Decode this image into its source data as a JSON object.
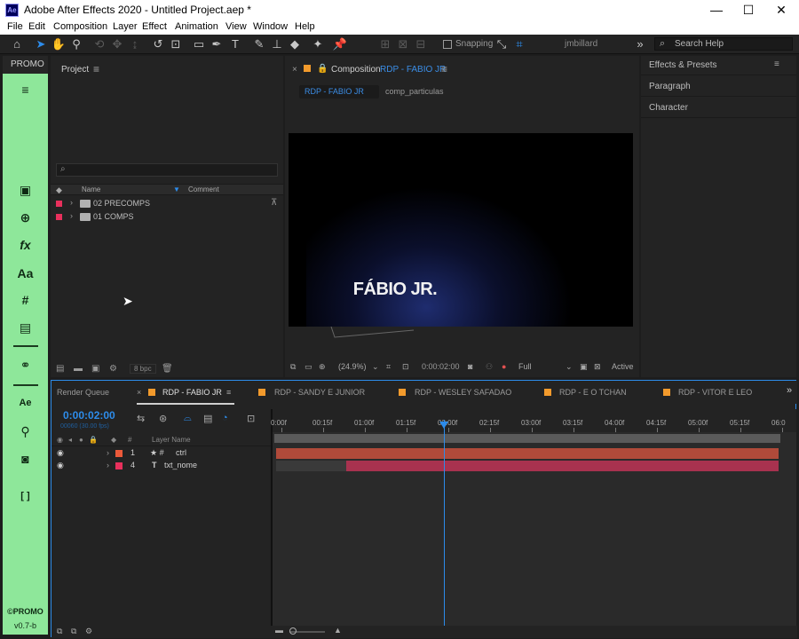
{
  "app": {
    "icon": "Ae",
    "title": "Adobe After Effects 2020 - Untitled Project.aep *",
    "window_buttons": [
      "—",
      "☐",
      "✕"
    ]
  },
  "menu": [
    "File",
    "Edit",
    "Composition",
    "Layer",
    "Effect",
    "Animation",
    "View",
    "Window",
    "Help"
  ],
  "toolbar": {
    "snapping_label": "Snapping",
    "workspace": "jmbillard",
    "search_placeholder": "Search Help"
  },
  "promo": {
    "tab_label": "PROMO",
    "logo": "©PROMO",
    "version": "v0.7-b",
    "icons": [
      "menu-icon",
      "comp-icon",
      "align-icon",
      "fx-icon",
      "text-icon",
      "grid-icon",
      "calendar-icon",
      "link-icon",
      "ae-icon",
      "search-icon",
      "camera-icon",
      "brackets-icon"
    ]
  },
  "project": {
    "tab_label": "Project",
    "columns": {
      "name": "Name",
      "comment": "Comment"
    },
    "items": [
      {
        "name": "02 PRECOMPS",
        "label_color": "#e8305c"
      },
      {
        "name": "01 COMPS",
        "label_color": "#e8305c"
      }
    ],
    "bpc": "8 bpc"
  },
  "composition": {
    "tab_prefix": "Composition",
    "tab_name": "RDP - FABIO JR",
    "breadcrumb_active": "RDP - FABIO JR",
    "breadcrumb_next": "comp_particulas",
    "viewer_text": "FÁBIO JR.",
    "zoom": "(24.9%)",
    "timecode": "0:00:02:00",
    "resolution": "Full",
    "camera": "Active"
  },
  "right_panels": [
    "Effects & Presets",
    "Paragraph",
    "Character"
  ],
  "timeline": {
    "render_queue": "Render Queue",
    "tabs": [
      {
        "label": "RDP - FABIO JR",
        "active": true
      },
      {
        "label": "RDP - SANDY E JUNIOR",
        "active": false
      },
      {
        "label": "RDP - WESLEY SAFADAO",
        "active": false
      },
      {
        "label": "RDP - E O TCHAN",
        "active": false
      },
      {
        "label": "RDP - VITOR E LEO",
        "active": false
      }
    ],
    "timecode": "0:00:02:00",
    "fps": "00060 (30.00 fps)",
    "layer_name_header": "Layer Name",
    "ruler_labels": [
      "0:00f",
      "00:15f",
      "01:00f",
      "01:15f",
      "02:00f",
      "02:15f",
      "03:00f",
      "03:15f",
      "04:00f",
      "04:15f",
      "05:00f",
      "05:15f",
      "06:0"
    ],
    "layers": [
      {
        "index": "1",
        "name": "ctrl",
        "label_color": "#ec5a3a",
        "bar_color": "#b04a3a",
        "type_icon": "★ #"
      },
      {
        "index": "4",
        "name": "txt_nome",
        "label_color": "#e8305c",
        "bar_color": "#a8324f",
        "type_icon": "T"
      }
    ]
  }
}
